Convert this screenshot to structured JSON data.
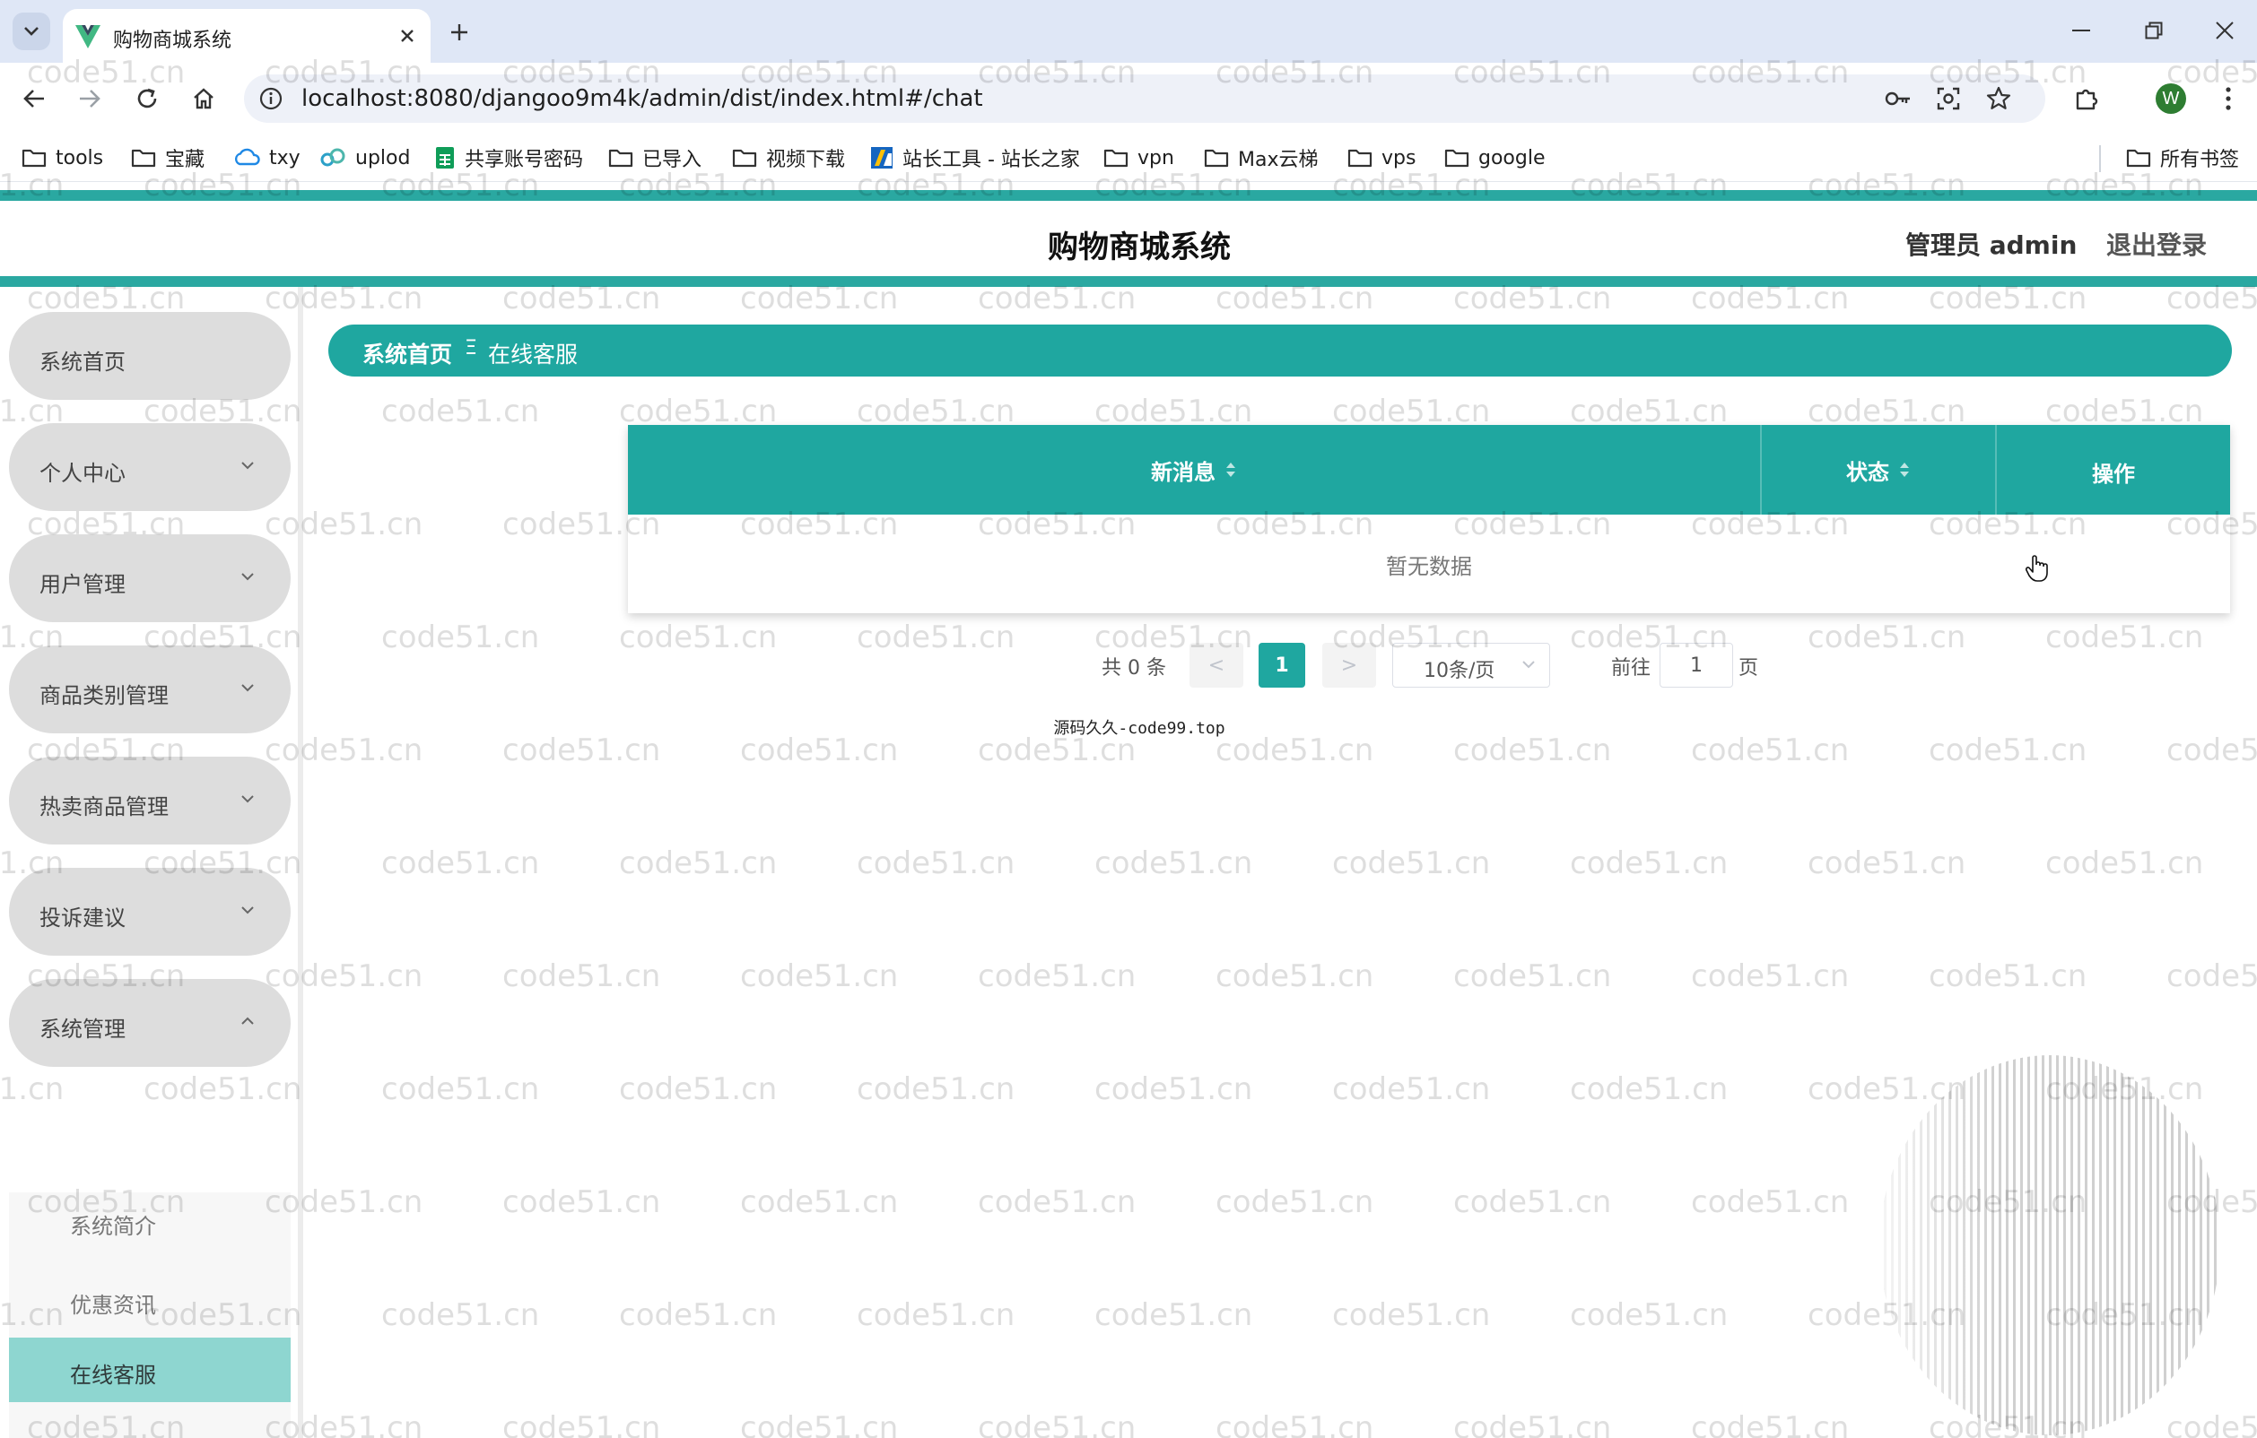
{
  "browser": {
    "tab_title": "购物商城系统",
    "url": "localhost:8080/djangoo9m4k/admin/dist/index.html#/chat",
    "profile_initial": "W",
    "bookmarks": [
      "tools",
      "宝藏",
      "txy",
      "uplod",
      "共享账号密码",
      "已导入",
      "视频下载",
      "站长工具 - 站长之家",
      "vpn",
      "Max云梯",
      "vps",
      "google"
    ],
    "all_bookmarks": "所有书签"
  },
  "header": {
    "title": "购物商城系统",
    "admin": "管理员 admin",
    "logout": "退出登录"
  },
  "sidebar": {
    "items": [
      {
        "label": "系统首页",
        "expandable": false
      },
      {
        "label": "个人中心",
        "expandable": true
      },
      {
        "label": "用户管理",
        "expandable": true
      },
      {
        "label": "商品类别管理",
        "expandable": true
      },
      {
        "label": "热卖商品管理",
        "expandable": true
      },
      {
        "label": "投诉建议",
        "expandable": true
      },
      {
        "label": "系统管理",
        "expandable": true,
        "expanded": true
      }
    ],
    "submenu": [
      {
        "label": "系统简介"
      },
      {
        "label": "优惠资讯"
      },
      {
        "label": "在线客服",
        "active": true
      }
    ]
  },
  "breadcrumb": {
    "home": "系统首页",
    "separator": "Ξ",
    "current": "在线客服"
  },
  "table": {
    "columns": [
      "新消息",
      "状态",
      "操作"
    ],
    "empty_text": "暂无数据"
  },
  "pagination": {
    "total": "共 0 条",
    "prev": "<",
    "page": "1",
    "next": ">",
    "page_size": "10条/页",
    "goto_label": "前往",
    "goto_value": "1",
    "page_suffix": "页"
  },
  "footer": {
    "text": "源码久久-code99.top"
  },
  "watermark_text": "code51.cn",
  "colors": {
    "accent": "#1fa7a0",
    "menu_bg": "#dddddd",
    "active_submenu": "#8ed6d0"
  }
}
